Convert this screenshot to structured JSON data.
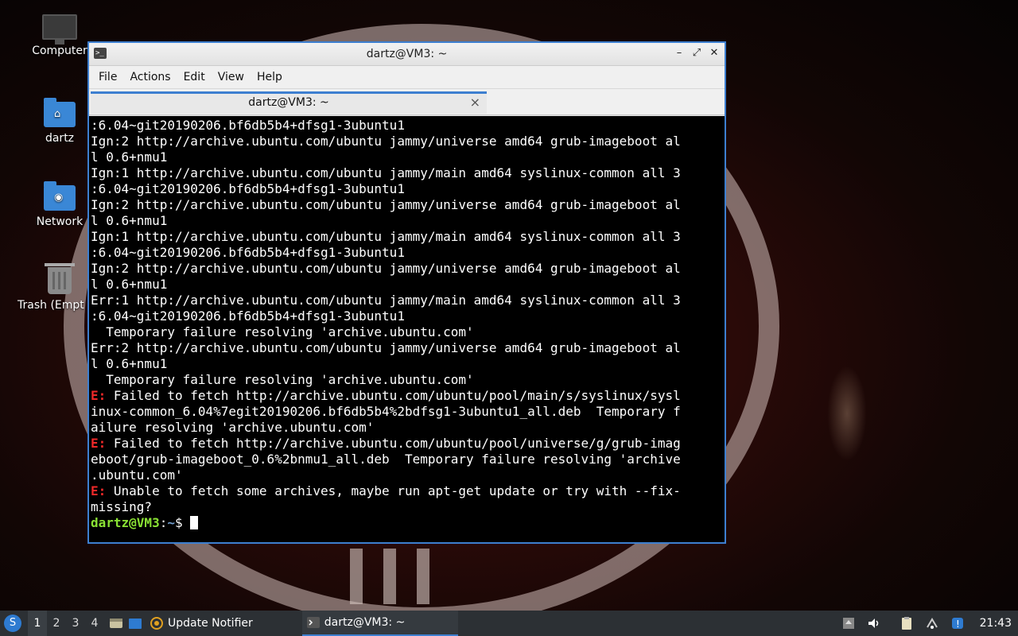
{
  "desktop": {
    "icons": [
      {
        "label": "Computer",
        "icon": "computer-icon"
      },
      {
        "label": "dartz",
        "icon": "home-folder-icon"
      },
      {
        "label": "Network",
        "icon": "network-folder-icon"
      },
      {
        "label": "Trash (Empt",
        "icon": "trash-icon"
      }
    ]
  },
  "window": {
    "title": "dartz@VM3: ~",
    "controls": {
      "minimize": "–",
      "maximize": "⤢",
      "close": "✕"
    },
    "menu": [
      "File",
      "Actions",
      "Edit",
      "View",
      "Help"
    ],
    "tab": {
      "label": "dartz@VM3: ~",
      "close": "×"
    }
  },
  "terminal": {
    "lines": [
      ":6.04~git20190206.bf6db5b4+dfsg1-3ubuntu1",
      "Ign:2 http://archive.ubuntu.com/ubuntu jammy/universe amd64 grub-imageboot al",
      "l 0.6+nmu1",
      "Ign:1 http://archive.ubuntu.com/ubuntu jammy/main amd64 syslinux-common all 3",
      ":6.04~git20190206.bf6db5b4+dfsg1-3ubuntu1",
      "Ign:2 http://archive.ubuntu.com/ubuntu jammy/universe amd64 grub-imageboot al",
      "l 0.6+nmu1",
      "Ign:1 http://archive.ubuntu.com/ubuntu jammy/main amd64 syslinux-common all 3",
      ":6.04~git20190206.bf6db5b4+dfsg1-3ubuntu1",
      "Ign:2 http://archive.ubuntu.com/ubuntu jammy/universe amd64 grub-imageboot al",
      "l 0.6+nmu1",
      "Err:1 http://archive.ubuntu.com/ubuntu jammy/main amd64 syslinux-common all 3",
      ":6.04~git20190206.bf6db5b4+dfsg1-3ubuntu1",
      "  Temporary failure resolving 'archive.ubuntu.com'",
      "Err:2 http://archive.ubuntu.com/ubuntu jammy/universe amd64 grub-imageboot al",
      "l 0.6+nmu1",
      "  Temporary failure resolving 'archive.ubuntu.com'"
    ],
    "error_prefix": "E:",
    "error_lines": [
      " Failed to fetch http://archive.ubuntu.com/ubuntu/pool/main/s/syslinux/sysl",
      "inux-common_6.04%7egit20190206.bf6db5b4%2bdfsg1-3ubuntu1_all.deb  Temporary f",
      "ailure resolving 'archive.ubuntu.com'",
      " Failed to fetch http://archive.ubuntu.com/ubuntu/pool/universe/g/grub-imag",
      "eboot/grub-imageboot_0.6%2bnmu1_all.deb  Temporary failure resolving 'archive",
      ".ubuntu.com'",
      " Unable to fetch some archives, maybe run apt-get update or try with --fix-",
      "missing?"
    ],
    "prompt": {
      "user": "dartz@VM3",
      "sep": ":",
      "path": "~",
      "symbol": "$ "
    }
  },
  "taskbar": {
    "start_icon": "start-menu-icon",
    "workspaces": [
      "1",
      "2",
      "3",
      "4"
    ],
    "active_workspace": "1",
    "tasks": [
      {
        "label": "Update Notifier",
        "icon": "update-notifier-icon"
      },
      {
        "label": "dartz@VM3: ~",
        "icon": "terminal-icon"
      }
    ],
    "tray_icons": [
      "disk-icon",
      "volume-icon",
      "clipboard-icon",
      "network-icon",
      "update-icon"
    ],
    "clock": "21:43"
  },
  "colors": {
    "accent": "#3d7fd0",
    "error": "#ef2929",
    "prompt_user": "#8ae234",
    "prompt_path": "#729fcf",
    "terminal_bg": "#000000",
    "taskbar_bg": "#2c3034"
  }
}
